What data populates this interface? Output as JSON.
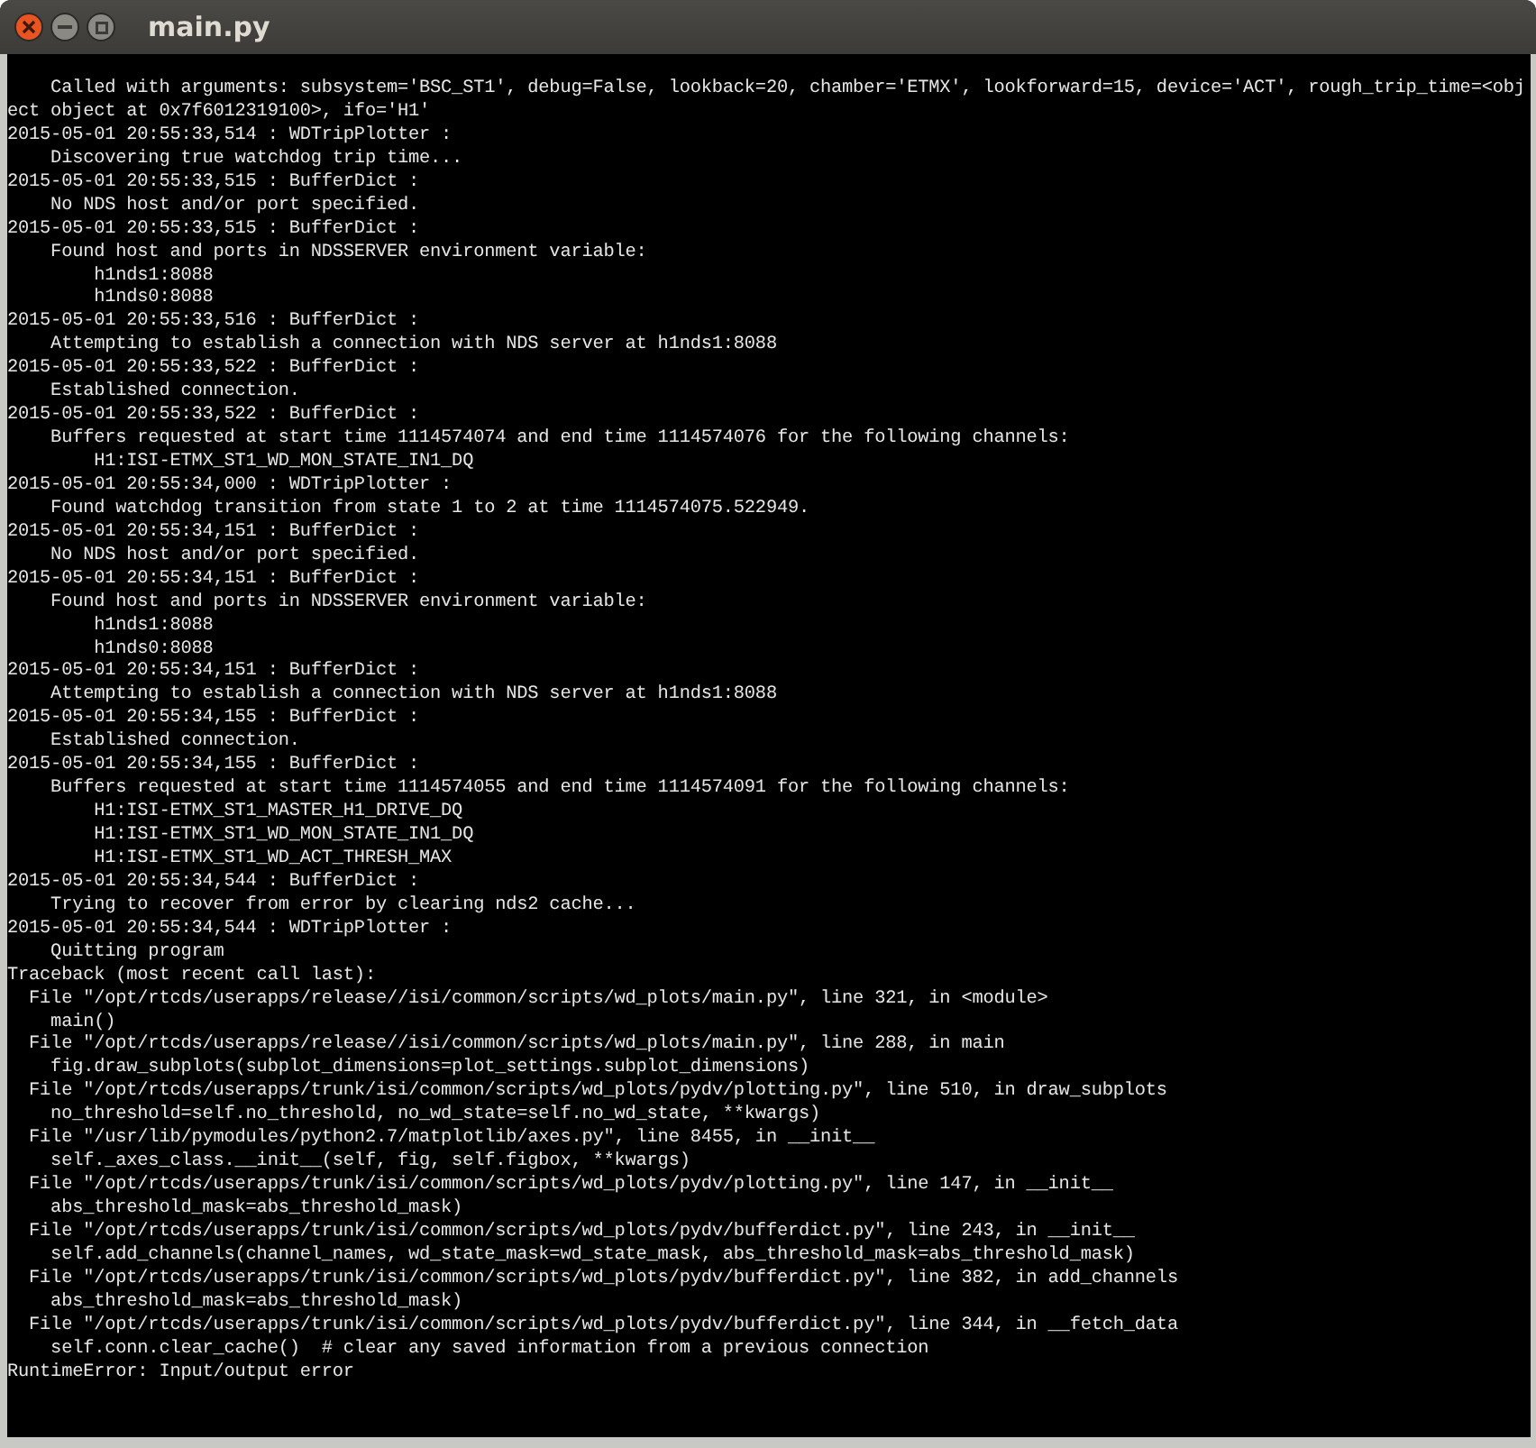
{
  "window": {
    "title": "main.py"
  },
  "terminal": {
    "lines": [
      "    Called with arguments: subsystem='BSC_ST1', debug=False, lookback=20, chamber='ETMX', lookforward=15, device='ACT', rough_trip_time=<obj",
      "ect object at 0x7f6012319100>, ifo='H1'",
      "2015-05-01 20:55:33,514 : WDTripPlotter :",
      "    Discovering true watchdog trip time...",
      "2015-05-01 20:55:33,515 : BufferDict :",
      "    No NDS host and/or port specified.",
      "2015-05-01 20:55:33,515 : BufferDict :",
      "    Found host and ports in NDSSERVER environment variable:",
      "        h1nds1:8088",
      "        h1nds0:8088",
      "2015-05-01 20:55:33,516 : BufferDict :",
      "    Attempting to establish a connection with NDS server at h1nds1:8088",
      "2015-05-01 20:55:33,522 : BufferDict :",
      "    Established connection.",
      "2015-05-01 20:55:33,522 : BufferDict :",
      "    Buffers requested at start time 1114574074 and end time 1114574076 for the following channels:",
      "        H1:ISI-ETMX_ST1_WD_MON_STATE_IN1_DQ",
      "2015-05-01 20:55:34,000 : WDTripPlotter :",
      "    Found watchdog transition from state 1 to 2 at time 1114574075.522949.",
      "2015-05-01 20:55:34,151 : BufferDict :",
      "    No NDS host and/or port specified.",
      "2015-05-01 20:55:34,151 : BufferDict :",
      "    Found host and ports in NDSSERVER environment variable:",
      "        h1nds1:8088",
      "        h1nds0:8088",
      "2015-05-01 20:55:34,151 : BufferDict :",
      "    Attempting to establish a connection with NDS server at h1nds1:8088",
      "2015-05-01 20:55:34,155 : BufferDict :",
      "    Established connection.",
      "2015-05-01 20:55:34,155 : BufferDict :",
      "    Buffers requested at start time 1114574055 and end time 1114574091 for the following channels:",
      "        H1:ISI-ETMX_ST1_MASTER_H1_DRIVE_DQ",
      "        H1:ISI-ETMX_ST1_WD_MON_STATE_IN1_DQ",
      "        H1:ISI-ETMX_ST1_WD_ACT_THRESH_MAX",
      "2015-05-01 20:55:34,544 : BufferDict :",
      "    Trying to recover from error by clearing nds2 cache...",
      "2015-05-01 20:55:34,544 : WDTripPlotter :",
      "    Quitting program",
      "Traceback (most recent call last):",
      "  File \"/opt/rtcds/userapps/release//isi/common/scripts/wd_plots/main.py\", line 321, in <module>",
      "    main()",
      "  File \"/opt/rtcds/userapps/release//isi/common/scripts/wd_plots/main.py\", line 288, in main",
      "    fig.draw_subplots(subplot_dimensions=plot_settings.subplot_dimensions)",
      "  File \"/opt/rtcds/userapps/trunk/isi/common/scripts/wd_plots/pydv/plotting.py\", line 510, in draw_subplots",
      "    no_threshold=self.no_threshold, no_wd_state=self.no_wd_state, **kwargs)",
      "  File \"/usr/lib/pymodules/python2.7/matplotlib/axes.py\", line 8455, in __init__",
      "    self._axes_class.__init__(self, fig, self.figbox, **kwargs)",
      "  File \"/opt/rtcds/userapps/trunk/isi/common/scripts/wd_plots/pydv/plotting.py\", line 147, in __init__",
      "    abs_threshold_mask=abs_threshold_mask)",
      "  File \"/opt/rtcds/userapps/trunk/isi/common/scripts/wd_plots/pydv/bufferdict.py\", line 243, in __init__",
      "    self.add_channels(channel_names, wd_state_mask=wd_state_mask, abs_threshold_mask=abs_threshold_mask)",
      "  File \"/opt/rtcds/userapps/trunk/isi/common/scripts/wd_plots/pydv/bufferdict.py\", line 382, in add_channels",
      "    abs_threshold_mask=abs_threshold_mask)",
      "  File \"/opt/rtcds/userapps/trunk/isi/common/scripts/wd_plots/pydv/bufferdict.py\", line 344, in __fetch_data",
      "    self.conn.clear_cache()  # clear any saved information from a previous connection",
      "RuntimeError: Input/output error"
    ]
  }
}
